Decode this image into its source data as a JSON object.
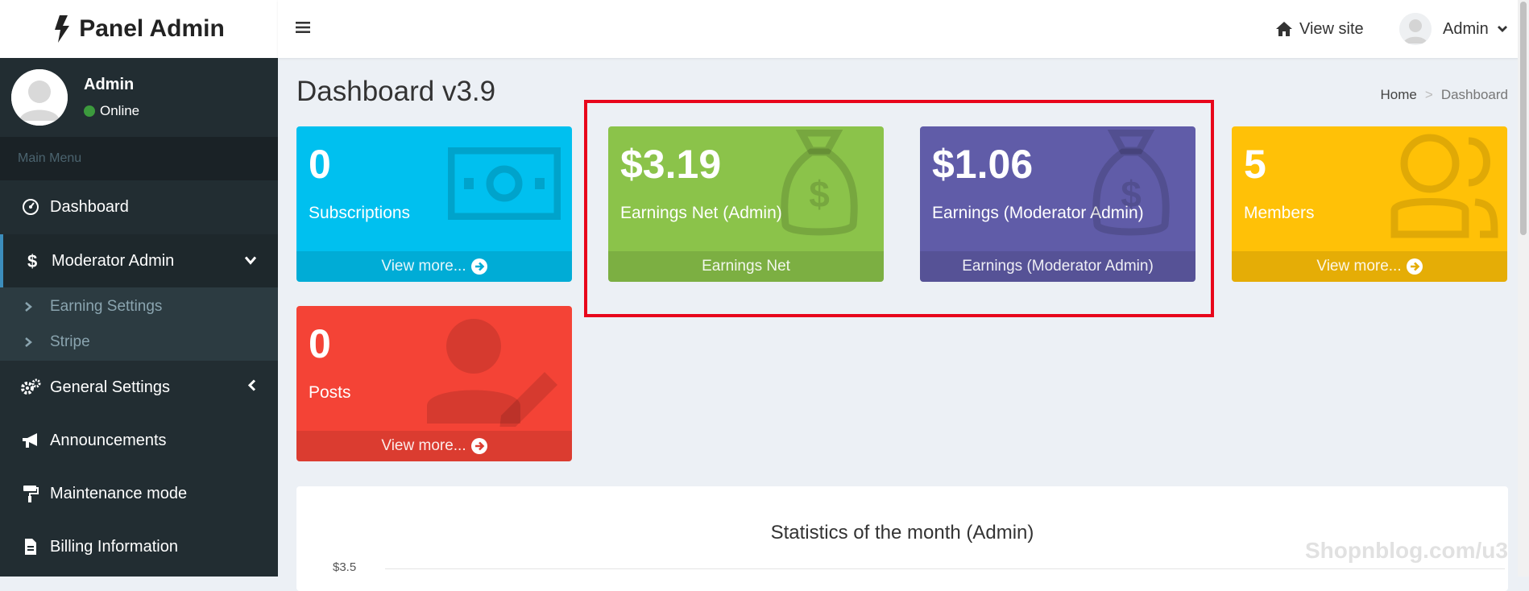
{
  "app": {
    "brand": "Panel Admin"
  },
  "user_panel": {
    "name": "Admin",
    "status": "Online"
  },
  "sidebar": {
    "header": "Main Menu",
    "items": [
      {
        "label": "Dashboard",
        "icon": "dashboard-icon"
      },
      {
        "label": "Moderator Admin",
        "icon": "dollar-icon",
        "expanded": true
      },
      {
        "label": "General Settings",
        "icon": "cogs-icon"
      },
      {
        "label": "Announcements",
        "icon": "megaphone-icon"
      },
      {
        "label": "Maintenance mode",
        "icon": "paint-roller-icon"
      },
      {
        "label": "Billing Information",
        "icon": "file-icon"
      }
    ],
    "submenu": [
      {
        "label": "Earning Settings"
      },
      {
        "label": "Stripe"
      }
    ]
  },
  "topbar": {
    "view_site": "View site",
    "user": "Admin"
  },
  "page": {
    "title": "Dashboard v3.9",
    "breadcrumb": {
      "home": "Home",
      "sep": ">",
      "current": "Dashboard"
    }
  },
  "boxes": [
    {
      "value": "0",
      "label": "Subscriptions",
      "footer": "View more...",
      "color": "#00c0ef",
      "icon": "money-bill-icon"
    },
    {
      "value": "$3.19",
      "label": "Earnings Net (Admin)",
      "footer": "Earnings Net",
      "color": "#8bc34a",
      "icon": "money-bag-icon"
    },
    {
      "value": "$1.06",
      "label": "Earnings (Moderator Admin)",
      "footer": "Earnings (Moderator Admin)",
      "color": "#605ca8",
      "icon": "money-bag-icon"
    },
    {
      "value": "5",
      "label": "Members",
      "footer": "View more...",
      "color": "#ffc107",
      "icon": "users-icon"
    },
    {
      "value": "0",
      "label": "Posts",
      "footer": "View more...",
      "color": "#f44336",
      "icon": "user-edit-icon"
    }
  ],
  "stats": {
    "title": "Statistics of the month (Admin)",
    "y_top": "$3.5"
  },
  "watermark": "Shopnblog.com/u3"
}
